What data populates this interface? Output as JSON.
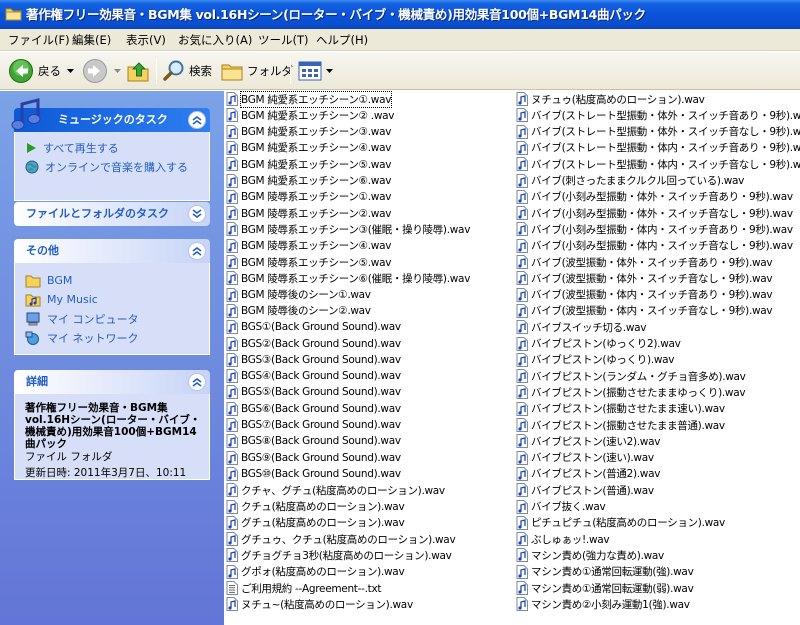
{
  "window": {
    "title": "著作権フリー効果音・BGM集 vol.16Hシーン(ローター・バイブ・機械責め)用効果音100個+BGM14曲パック"
  },
  "menu": [
    "ファイル(F)",
    "編集(E)",
    "表示(V)",
    "お気に入り(A)",
    "ツール(T)",
    "ヘルプ(H)"
  ],
  "toolbar": {
    "back_label": "戻る",
    "search_label": "検索",
    "folders_label": "フォルダ"
  },
  "taskpane": {
    "music_tasks": {
      "title": "ミュージックのタスク",
      "items": [
        "すべて再生する",
        "オンラインで音楽を購入する"
      ]
    },
    "file_folder_tasks": {
      "title": "ファイルとフォルダのタスク"
    },
    "other_places": {
      "title": "その他",
      "items": [
        "BGM",
        "My Music",
        "マイ コンピュータ",
        "マイ ネットワーク"
      ]
    },
    "details": {
      "title": "詳細",
      "name": "著作権フリー効果音・BGM集 vol.16Hシーン(ローター・バイブ・機械責め)用効果音100個+BGM14曲パック",
      "type": "ファイル フォルダ",
      "modified": "更新日時: 2011年3月7日、10:11"
    }
  },
  "files": {
    "column1": [
      {
        "name": "BGM 純愛系エッチシーン①.wav",
        "icon": "audio-file-icon"
      },
      {
        "name": "BGM 純愛系エッチシーン② .wav",
        "icon": "audio-file-icon"
      },
      {
        "name": "BGM 純愛系エッチシーン③.wav",
        "icon": "audio-file-icon"
      },
      {
        "name": "BGM 純愛系エッチシーン④.wav",
        "icon": "audio-file-icon"
      },
      {
        "name": "BGM 純愛系エッチシーン⑤.wav",
        "icon": "audio-file-icon"
      },
      {
        "name": "BGM 純愛系エッチシーン⑥.wav",
        "icon": "audio-file-icon"
      },
      {
        "name": "BGM 陵辱系エッチシーン①.wav",
        "icon": "audio-file-icon"
      },
      {
        "name": "BGM 陵辱系エッチシーン②.wav",
        "icon": "audio-file-icon"
      },
      {
        "name": "BGM 陵辱系エッチシーン③(催眠・操り陵辱).wav",
        "icon": "audio-file-icon"
      },
      {
        "name": "BGM 陵辱系エッチシーン④.wav",
        "icon": "audio-file-icon"
      },
      {
        "name": "BGM 陵辱系エッチシーン⑤.wav",
        "icon": "audio-file-icon"
      },
      {
        "name": "BGM 陵辱系エッチシーン⑥(催眠・操り陵辱).wav",
        "icon": "audio-file-icon"
      },
      {
        "name": "BGM 陵辱後のシーン①.wav",
        "icon": "audio-file-icon"
      },
      {
        "name": "BGM 陵辱後のシーン②.wav",
        "icon": "audio-file-icon"
      },
      {
        "name": "BGS①(Back Ground Sound).wav",
        "icon": "audio-file-icon"
      },
      {
        "name": "BGS②(Back Ground Sound).wav",
        "icon": "audio-file-icon"
      },
      {
        "name": "BGS③(Back Ground Sound).wav",
        "icon": "audio-file-icon"
      },
      {
        "name": "BGS④(Back Ground Sound).wav",
        "icon": "audio-file-icon"
      },
      {
        "name": "BGS⑤(Back Ground Sound).wav",
        "icon": "audio-file-icon"
      },
      {
        "name": "BGS⑥(Back Ground Sound).wav",
        "icon": "audio-file-icon"
      },
      {
        "name": "BGS⑦(Back Ground Sound).wav",
        "icon": "audio-file-icon"
      },
      {
        "name": "BGS⑧(Back Ground Sound).wav",
        "icon": "audio-file-icon"
      },
      {
        "name": "BGS⑨(Back Ground Sound).wav",
        "icon": "audio-file-icon"
      },
      {
        "name": "BGS⑩(Back Ground Sound).wav",
        "icon": "audio-file-icon"
      },
      {
        "name": "クチャ、グチュ(粘度高めのローション).wav",
        "icon": "audio-file-icon"
      },
      {
        "name": "クチュ(粘度高めのローション).wav",
        "icon": "audio-file-icon"
      },
      {
        "name": "グチュ(粘度高めのローション).wav",
        "icon": "audio-file-icon"
      },
      {
        "name": "グチュゥ、クチュ(粘度高めのローション).wav",
        "icon": "audio-file-icon"
      },
      {
        "name": "グチョグチョ3秒(粘度高めのローション).wav",
        "icon": "audio-file-icon"
      },
      {
        "name": "グポォ(粘度高めのローション).wav",
        "icon": "audio-file-icon"
      },
      {
        "name": "ご利用規約 --Agreement--.txt",
        "icon": "text-file-icon"
      },
      {
        "name": "ヌチュ~(粘度高めのローション).wav",
        "icon": "audio-file-icon"
      }
    ],
    "column2": [
      {
        "name": "ヌチュゥ(粘度高めのローション).wav",
        "icon": "audio-file-icon"
      },
      {
        "name": "バイブ(ストレート型振動・体外・スイッチ音あり・9秒).wav",
        "icon": "audio-file-icon"
      },
      {
        "name": "バイブ(ストレート型振動・体外・スイッチ音なし・9秒).wav",
        "icon": "audio-file-icon"
      },
      {
        "name": "バイブ(ストレート型振動・体内・スイッチ音あり・9秒).wav",
        "icon": "audio-file-icon"
      },
      {
        "name": "バイブ(ストレート型振動・体内・スイッチ音なし・9秒).wav",
        "icon": "audio-file-icon"
      },
      {
        "name": "バイブ(刺さったままクルクル回っている).wav",
        "icon": "audio-file-icon"
      },
      {
        "name": "バイブ(小刻み型振動・体外・スイッチ音あり・9秒).wav",
        "icon": "audio-file-icon"
      },
      {
        "name": "バイブ(小刻み型振動・体外・スイッチ音なし・9秒).wav",
        "icon": "audio-file-icon"
      },
      {
        "name": "バイブ(小刻み型振動・体内・スイッチ音あり・9秒).wav",
        "icon": "audio-file-icon"
      },
      {
        "name": "バイブ(小刻み型振動・体内・スイッチ音なし・9秒).wav",
        "icon": "audio-file-icon"
      },
      {
        "name": "バイブ(波型振動・体外・スイッチ音あり・9秒).wav",
        "icon": "audio-file-icon"
      },
      {
        "name": "バイブ(波型振動・体外・スイッチ音なし・9秒).wav",
        "icon": "audio-file-icon"
      },
      {
        "name": "バイブ(波型振動・体内・スイッチ音あり・9秒).wav",
        "icon": "audio-file-icon"
      },
      {
        "name": "バイブ(波型振動・体内・スイッチ音なし・9秒).wav",
        "icon": "audio-file-icon"
      },
      {
        "name": "バイブスイッチ切る.wav",
        "icon": "audio-file-icon"
      },
      {
        "name": "バイブピストン(ゆっくり2).wav",
        "icon": "audio-file-icon"
      },
      {
        "name": "バイブピストン(ゆっくり).wav",
        "icon": "audio-file-icon"
      },
      {
        "name": "バイブピストン(ランダム・グチョ音多め).wav",
        "icon": "audio-file-icon"
      },
      {
        "name": "バイブピストン(振動させたままゆっくり).wav",
        "icon": "audio-file-icon"
      },
      {
        "name": "バイブピストン(振動させたまま速い).wav",
        "icon": "audio-file-icon"
      },
      {
        "name": "バイブピストン(振動させたまま普通).wav",
        "icon": "audio-file-icon"
      },
      {
        "name": "バイブピストン(速い2).wav",
        "icon": "audio-file-icon"
      },
      {
        "name": "バイブピストン(速い).wav",
        "icon": "audio-file-icon"
      },
      {
        "name": "バイブピストン(普通2).wav",
        "icon": "audio-file-icon"
      },
      {
        "name": "バイブピストン(普通).wav",
        "icon": "audio-file-icon"
      },
      {
        "name": "バイブ抜く.wav",
        "icon": "audio-file-icon"
      },
      {
        "name": "ピチュピチュ(粘度高めのローション).wav",
        "icon": "audio-file-icon"
      },
      {
        "name": "ぶしゅぁッ!.wav",
        "icon": "audio-file-icon"
      },
      {
        "name": "マシン責め(強力な責め).wav",
        "icon": "audio-file-icon"
      },
      {
        "name": "マシン責め①通常回転運動(強).wav",
        "icon": "audio-file-icon"
      },
      {
        "name": "マシン責め①通常回転運動(弱).wav",
        "icon": "audio-file-icon"
      },
      {
        "name": "マシン責め②小刻み運動1(強).wav",
        "icon": "audio-file-icon"
      }
    ]
  }
}
